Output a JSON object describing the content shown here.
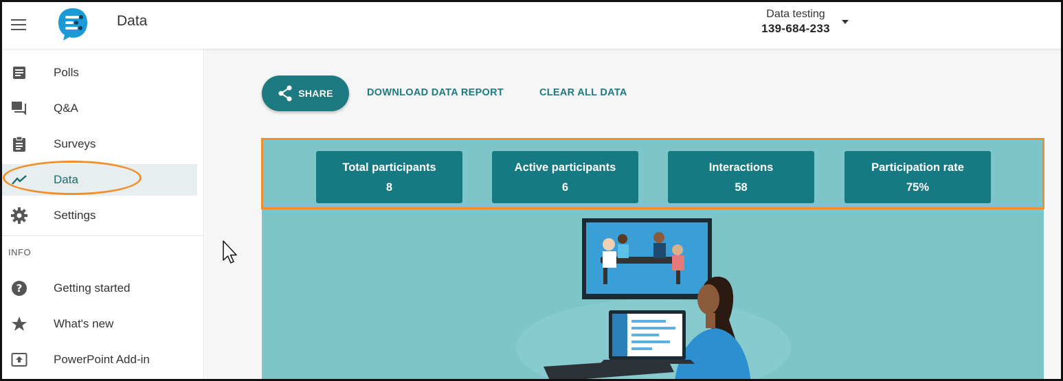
{
  "header": {
    "app_title": "Data",
    "session_name": "Data testing",
    "session_code": "139-684-233"
  },
  "sidebar": {
    "items": [
      {
        "label": "Polls",
        "icon": "document-icon"
      },
      {
        "label": "Q&A",
        "icon": "chat-icon"
      },
      {
        "label": "Surveys",
        "icon": "clipboard-icon"
      },
      {
        "label": "Data",
        "icon": "trend-line-icon",
        "active": true
      },
      {
        "label": "Settings",
        "icon": "gear-icon"
      }
    ],
    "info_heading": "INFO",
    "info_items": [
      {
        "label": "Getting started",
        "icon": "help-icon"
      },
      {
        "label": "What's new",
        "icon": "star-icon"
      },
      {
        "label": "PowerPoint Add-in",
        "icon": "upload-icon"
      }
    ]
  },
  "toolbar": {
    "share_label": "SHARE",
    "download_label": "DOWNLOAD DATA REPORT",
    "clear_label": "CLEAR ALL DATA"
  },
  "stats": [
    {
      "label": "Total participants",
      "value": "8"
    },
    {
      "label": "Active participants",
      "value": "6"
    },
    {
      "label": "Interactions",
      "value": "58"
    },
    {
      "label": "Participation rate",
      "value": "75%"
    }
  ],
  "colors": {
    "accent": "#1d7a80",
    "stat_card": "#157a81",
    "panel": "#7ec5c9",
    "highlight": "#f0902c"
  }
}
